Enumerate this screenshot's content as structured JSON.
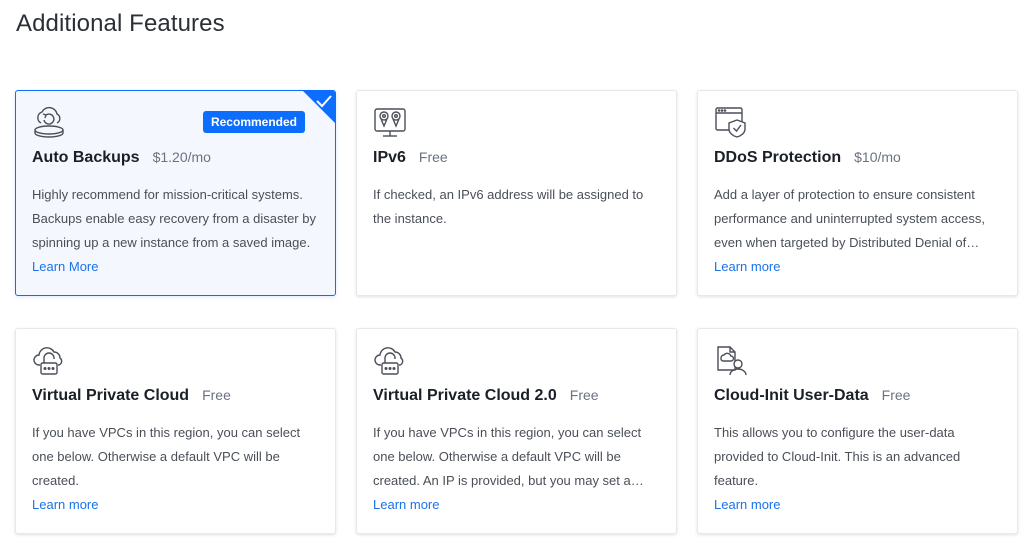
{
  "page": {
    "title": "Additional Features"
  },
  "colors": {
    "accent": "#0d6efd",
    "link": "#1a73e8",
    "selected_bg": "#f4f8fe"
  },
  "cards": [
    {
      "icon": "cloud-backup-icon",
      "name": "Auto Backups",
      "price": "$1.20/mo",
      "badge": "Recommended",
      "selected": true,
      "description": "Highly recommend for mission-critical systems. Backups enable easy recovery from a disaster by spinning up a new instance from a saved image.",
      "link": "Learn More"
    },
    {
      "icon": "ipv6-location-icon",
      "name": "IPv6",
      "price": "Free",
      "selected": false,
      "description": "If checked, an IPv6 address will be assigned to the instance.",
      "link": ""
    },
    {
      "icon": "shield-window-icon",
      "name": "DDoS Protection",
      "price": "$10/mo",
      "selected": false,
      "description": "Add a layer of protection to ensure consistent performance and uninterrupted system access, even when targeted by Distributed Denial of Service attacks.",
      "link": "Learn more"
    },
    {
      "icon": "cloud-lock-icon",
      "name": "Virtual Private Cloud",
      "price": "Free",
      "selected": false,
      "description": "If you have VPCs in this region, you can select one below. Otherwise a default VPC will be created.",
      "link": "Learn more"
    },
    {
      "icon": "cloud-lock-icon",
      "name": "Virtual Private Cloud 2.0",
      "price": "Free",
      "selected": false,
      "description": "If you have VPCs in this region, you can select one below. Otherwise a default VPC will be created. An IP is provided, but you may set a custom IP range.",
      "link": "Learn more"
    },
    {
      "icon": "user-data-icon",
      "name": "Cloud-Init User-Data",
      "price": "Free",
      "selected": false,
      "description": "This allows you to configure the user-data provided to Cloud-Init. This is an advanced feature.",
      "link": "Learn more"
    }
  ]
}
